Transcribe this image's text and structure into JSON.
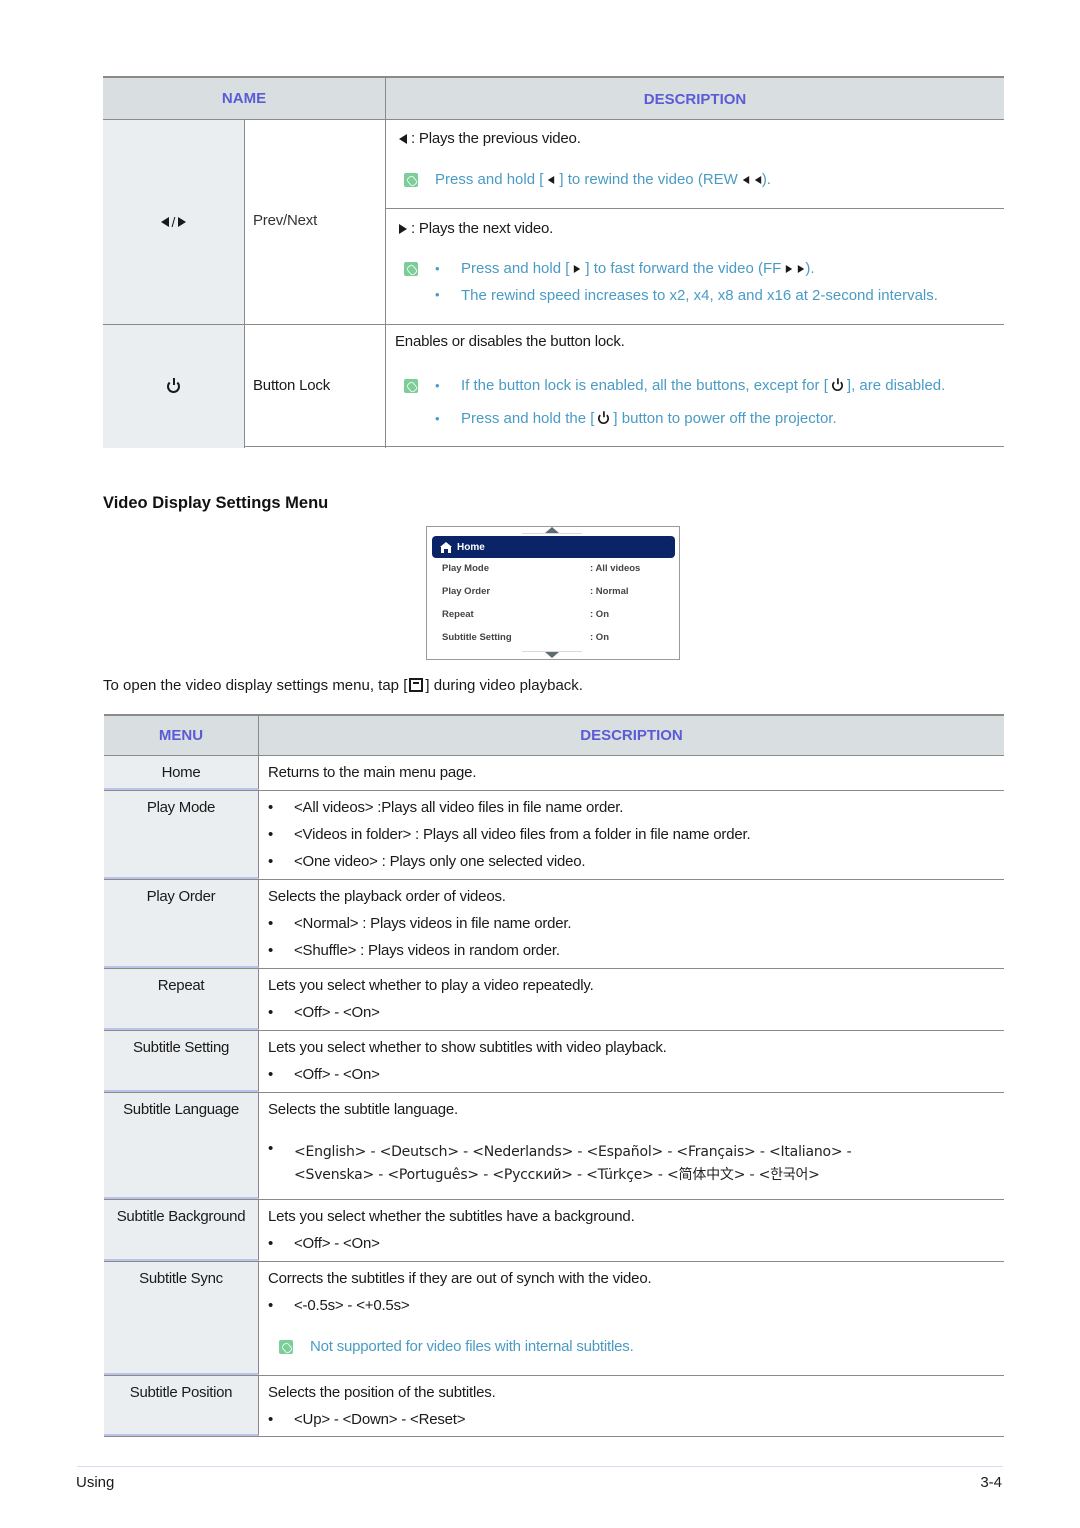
{
  "table1": {
    "headers": {
      "name": "NAME",
      "description": "DESCRIPTION"
    },
    "rows": [
      {
        "icon": "prev-next-icon",
        "name": "Prev/Next",
        "prev_desc": ": Plays the previous video.",
        "prev_note": {
          "pre": "Press and hold [",
          "mid": "] to rewind the video (REW",
          "post": ")."
        },
        "next_desc": ": Plays the next video.",
        "next_notes": [
          {
            "pre": "Press and hold [",
            "mid": "] to fast forward the video (FF",
            "post": ")."
          },
          {
            "text": "The rewind speed increases to x2, x4, x8 and x16 at 2-second intervals."
          }
        ]
      },
      {
        "icon": "power-icon",
        "name": "Button Lock",
        "desc": "Enables or disables the button lock.",
        "notes": [
          {
            "pre": "If the button lock is enabled, all the buttons, except for [",
            "post": "], are disabled."
          },
          {
            "pre": "Press and hold the [",
            "post": "] button to power off the projector."
          }
        ]
      }
    ]
  },
  "section_title": "Video Display Settings Menu",
  "menu_mockup": {
    "home_label": "Home",
    "items": [
      {
        "label": "Play Mode",
        "value": ": All videos"
      },
      {
        "label": "Play Order",
        "value": ": Normal"
      },
      {
        "label": "Repeat",
        "value": ": On"
      },
      {
        "label": "Subtitle Setting",
        "value": ": On"
      }
    ]
  },
  "intro": {
    "pre": "To open the video display settings menu, tap [",
    "post": "] during video playback."
  },
  "table2": {
    "headers": {
      "menu": "MENU",
      "description": "DESCRIPTION"
    },
    "rows": [
      {
        "name": "Home",
        "lines": [
          "Returns to the main menu page."
        ]
      },
      {
        "name": "Play Mode",
        "bullets": [
          "<All videos> :Plays all video files in file name order.",
          "<Videos in folder> : Plays all video files from a folder in file name order.",
          "<One video> : Plays only one selected video."
        ]
      },
      {
        "name": "Play Order",
        "lines": [
          "Selects the playback order of videos."
        ],
        "bullets": [
          "<Normal> : Plays videos in file name order.",
          "<Shuffle> : Plays videos in random order."
        ]
      },
      {
        "name": "Repeat",
        "lines": [
          "Lets you select whether to play a video repeatedly."
        ],
        "bullets": [
          "<Off> - <On>"
        ]
      },
      {
        "name": "Subtitle Setting",
        "lines": [
          "Lets you select whether to show subtitles with video playback."
        ],
        "bullets": [
          "<Off> - <On>"
        ]
      },
      {
        "name": "Subtitle Language",
        "lines": [
          "Selects the subtitle language."
        ],
        "lang_line1": "<English> - <Deutsch> - <Nederlands> - <Español> - <Français> - <Italiano> -",
        "lang_line2": "<Svenska> - <Português> - <Русский> - <Türkçe> - <简体中文> - <한국어>"
      },
      {
        "name": "Subtitle Background",
        "lines": [
          "Lets you select whether the subtitles have a background."
        ],
        "bullets": [
          "<Off> - <On>"
        ]
      },
      {
        "name": "Subtitle Sync",
        "lines": [
          "Corrects the subtitles if they are out of synch with the video."
        ],
        "bullets": [
          "<-0.5s> - <+0.5s>"
        ],
        "note": "Not supported for video files with internal subtitles."
      },
      {
        "name": "Subtitle Position",
        "lines": [
          "Selects the position of the subtitles."
        ],
        "bullets": [
          "<Up> - <Down> - <Reset>"
        ]
      }
    ]
  },
  "footer": {
    "left": "Using",
    "right": "3-4"
  },
  "colors": {
    "header_text": "#5b5bd6",
    "note_text": "#4a9bc4",
    "menu_highlight": "#0b2367",
    "header_bg": "#d9dfe1"
  }
}
